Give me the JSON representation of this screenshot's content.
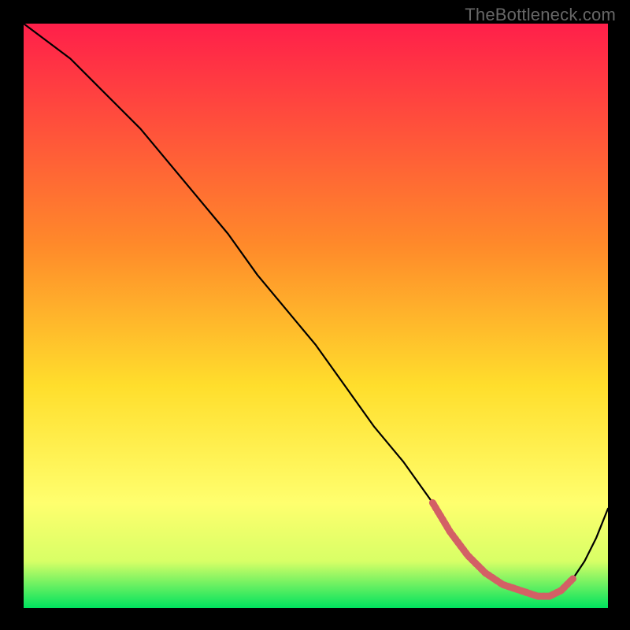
{
  "watermark": "TheBottleneck.com",
  "colors": {
    "dash": "#d36065",
    "grad_top": "#ff1f4a",
    "grad_mid1": "#ff8a2a",
    "grad_mid2": "#ffde2c",
    "grad_mid3": "#ffff6e",
    "grad_mid4": "#d8ff66",
    "grad_bottom": "#00e25e"
  },
  "chart_data": {
    "type": "line",
    "title": "",
    "xlabel": "",
    "ylabel": "",
    "xlim": [
      0,
      100
    ],
    "ylim": [
      0,
      100
    ],
    "series": [
      {
        "name": "curve",
        "x": [
          0,
          4,
          8,
          12,
          16,
          20,
          25,
          30,
          35,
          40,
          45,
          50,
          55,
          60,
          65,
          70,
          73,
          76,
          79,
          82,
          85,
          88,
          90,
          92,
          94,
          96,
          98,
          100
        ],
        "y": [
          100,
          97,
          94,
          90,
          86,
          82,
          76,
          70,
          64,
          57,
          51,
          45,
          38,
          31,
          25,
          18,
          13,
          9,
          6,
          4,
          3,
          2,
          2,
          3,
          5,
          8,
          12,
          17
        ]
      }
    ],
    "highlight": {
      "name": "dash-segment",
      "x": [
        70,
        73,
        76,
        79,
        82,
        85,
        88,
        90,
        92,
        94
      ],
      "y": [
        18,
        13,
        9,
        6,
        4,
        3,
        2,
        2,
        3,
        5
      ]
    }
  }
}
